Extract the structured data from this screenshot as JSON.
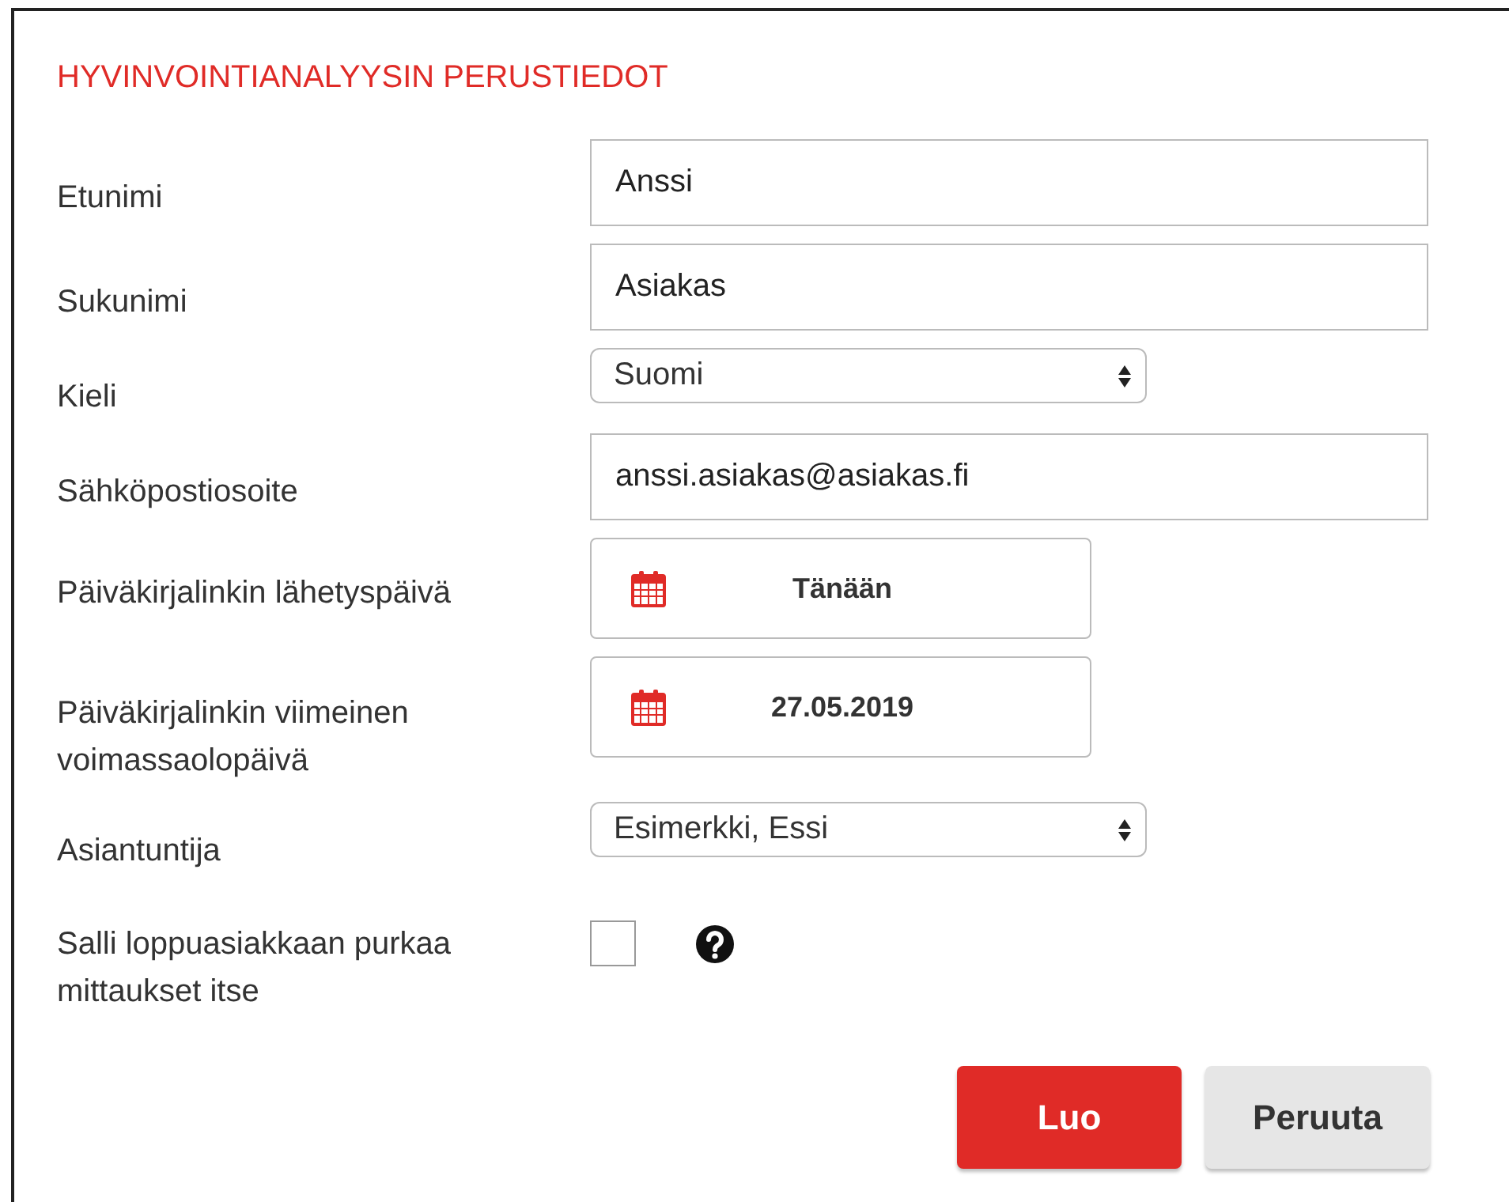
{
  "title": "HYVINVOINTIANALYYSIN PERUSTIEDOT",
  "fields": [
    {
      "kind": "text",
      "label": "Etunimi",
      "value": "Anssi"
    },
    {
      "kind": "text",
      "label": "Sukunimi",
      "value": "Asiakas"
    },
    {
      "kind": "select",
      "label": "Kieli",
      "value": "Suomi"
    },
    {
      "kind": "text",
      "label": "Sähköpostiosoite",
      "value": "anssi.asiakas@asiakas.fi"
    },
    {
      "kind": "date",
      "label": "Päiväkirjalinkin lähetyspäivä",
      "value": "Tänään"
    },
    {
      "kind": "date",
      "label": "Päiväkirjalinkin viimeinen voimassaolopäivä",
      "value": "27.05.2019"
    },
    {
      "kind": "select",
      "label": "Asiantuntija",
      "value": "Esimerkki, Essi"
    },
    {
      "kind": "checkbox",
      "label": "Salli loppuasiakkaan purkaa mittaukset itse",
      "checked": false,
      "help": true
    }
  ],
  "buttons": [
    {
      "label": "Luo",
      "kind": "primary"
    },
    {
      "label": "Peruuta",
      "kind": "secondary"
    }
  ]
}
